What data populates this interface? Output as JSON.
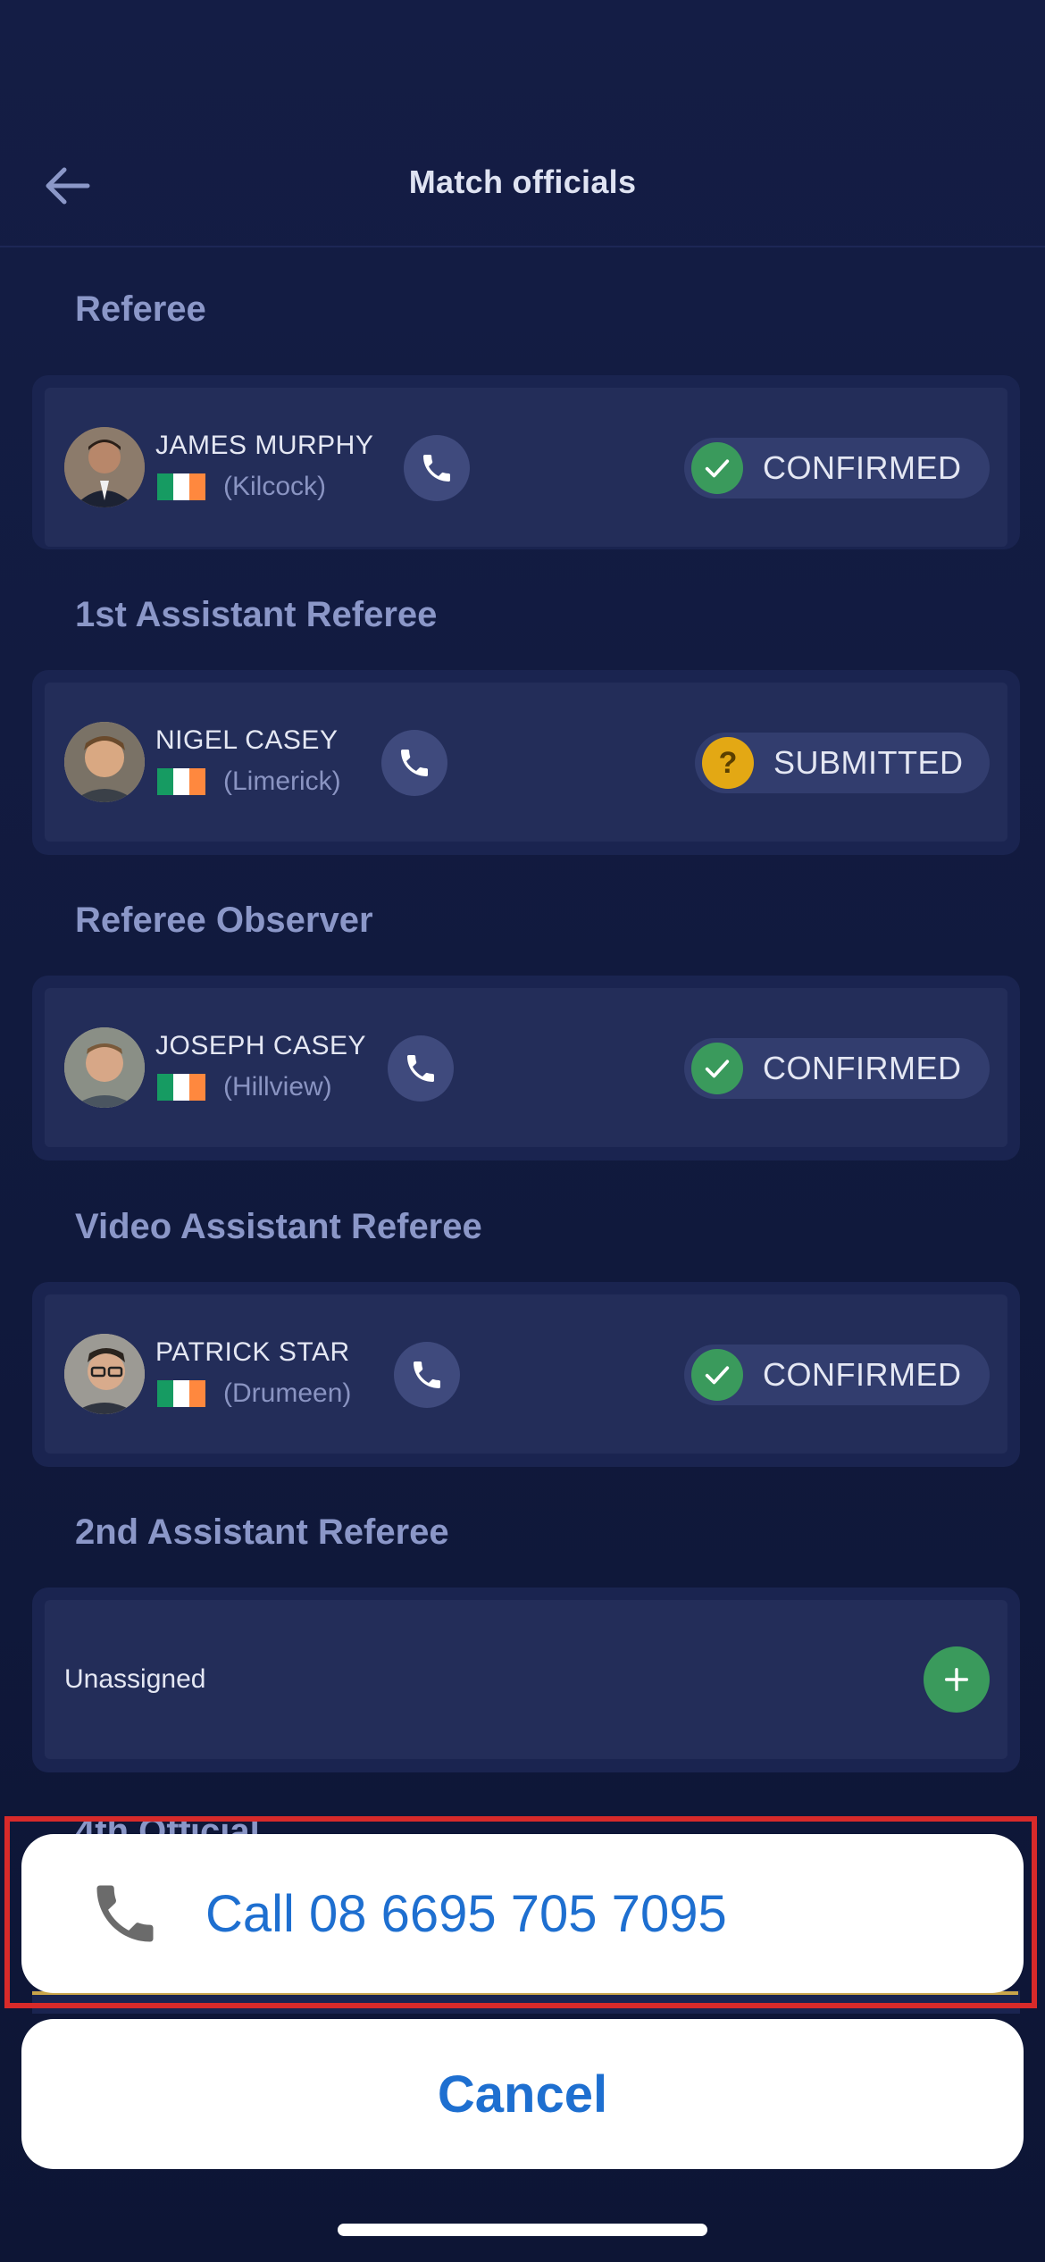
{
  "header": {
    "title": "Match officials",
    "back_icon": "arrow-left-icon"
  },
  "sections": [
    {
      "title": "Referee",
      "name": "JAMES MURPHY",
      "location": "(Kilcock)",
      "status": "CONFIRMED",
      "status_color": "#3a9a5c"
    },
    {
      "title": "1st Assistant Referee",
      "name": "NIGEL CASEY",
      "location": "(Limerick)",
      "status": "SUBMITTED",
      "status_color": "#e3a814"
    },
    {
      "title": "Referee Observer",
      "name": "JOSEPH CASEY",
      "location": "(Hillview)",
      "status": "CONFIRMED",
      "status_color": "#3a9a5c"
    },
    {
      "title": "Video Assistant Referee",
      "name": "PATRICK STAR",
      "location": "(Drumeen)",
      "status": "CONFIRMED",
      "status_color": "#3a9a5c"
    },
    {
      "title": "2nd Assistant Referee",
      "unassigned_label": "Unassigned"
    }
  ],
  "peek_section_title": "4th Official",
  "action_sheet": {
    "call_label": "Call 08 6695 705 7095",
    "cancel_label": "Cancel"
  },
  "colors": {
    "background": "#111a3e",
    "accent_blue": "#1e6fd0",
    "confirmed_green": "#3a9a5c",
    "submitted_yellow": "#e3a814",
    "highlight_red": "#d82a2a",
    "flag_green": "#169b62",
    "flag_white": "#ffffff",
    "flag_orange": "#ff883e"
  }
}
